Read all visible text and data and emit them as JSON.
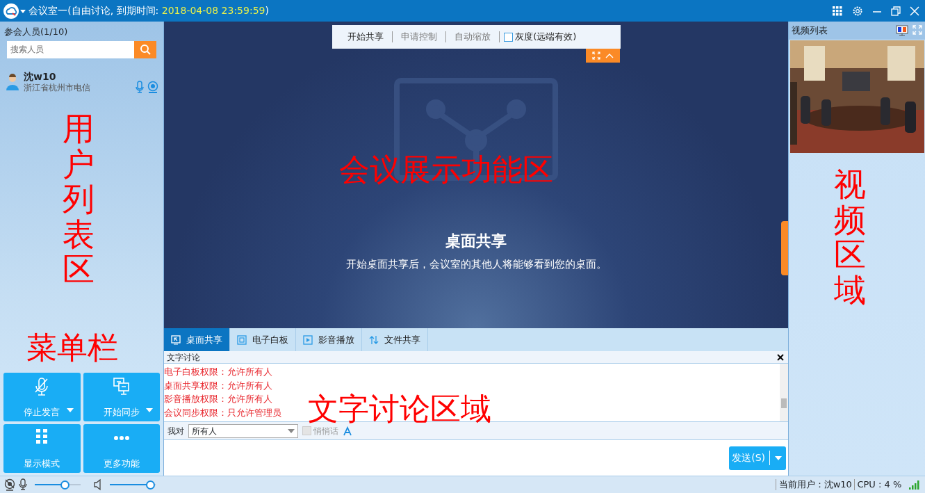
{
  "title_bar": {
    "room": "会议室一(自由讨论, 到期时间: ",
    "expiry": "2018-04-08 23:59:59",
    "suffix": ")"
  },
  "participants": {
    "header": "参会人员(1/10)",
    "search": {
      "placeholder": "搜索人员"
    },
    "users": [
      {
        "name": "沈w10",
        "location": "浙江省杭州市电信"
      }
    ]
  },
  "menu_buttons": [
    {
      "kind": "mic-off",
      "label": "停止发言",
      "dropdown": true
    },
    {
      "kind": "sync",
      "label": "开始同步",
      "dropdown": true
    },
    {
      "kind": "layout",
      "label": "显示模式",
      "dropdown": false
    },
    {
      "kind": "more",
      "label": "更多功能",
      "dropdown": false
    }
  ],
  "share_toolbar": {
    "buttons": [
      {
        "label": "开始共享",
        "disabled": false
      },
      {
        "label": "申请控制",
        "disabled": true
      },
      {
        "label": "自动缩放",
        "disabled": true
      }
    ],
    "grayscale": {
      "label": "灰度(远端有效)",
      "checked": false
    }
  },
  "display": {
    "title": "桌面共享",
    "subtitle": "开始桌面共享后，会议室的其他人将能够看到您的桌面。"
  },
  "tabs": [
    {
      "kind": "desktop",
      "label": "桌面共享",
      "selected": true
    },
    {
      "kind": "whiteboard",
      "label": "电子白板",
      "selected": false
    },
    {
      "kind": "media",
      "label": "影音播放",
      "selected": false
    },
    {
      "kind": "file",
      "label": "文件共享",
      "selected": false
    }
  ],
  "chat": {
    "title": "文字讨论",
    "messages": [
      "电子白板权限：允许所有人",
      "桌面共享权限：允许所有人",
      "影音播放权限：允许所有人",
      "会议同步权限：只允许管理员"
    ],
    "recipient_label": "我对",
    "recipient": "所有人",
    "whisper": {
      "label": "悄悄话",
      "checked": false,
      "disabled": true
    },
    "send": "发送(S)"
  },
  "video_panel": {
    "title": "视频列表"
  },
  "status_bar": {
    "sliders": [
      {
        "kind": "mic",
        "level": 0.65
      },
      {
        "kind": "speaker",
        "level": 0.88
      }
    ],
    "current_user": "当前用户：沈w10",
    "cpu": "CPU : 4 %"
  },
  "annotations": [
    {
      "text": "用户列表区",
      "vertical": true
    },
    {
      "text": "会议展示功能区",
      "vertical": false
    },
    {
      "text": "菜单栏",
      "vertical": false
    },
    {
      "text": "文字讨论区域",
      "vertical": false
    },
    {
      "text": "视频区域",
      "vertical": true
    }
  ]
}
